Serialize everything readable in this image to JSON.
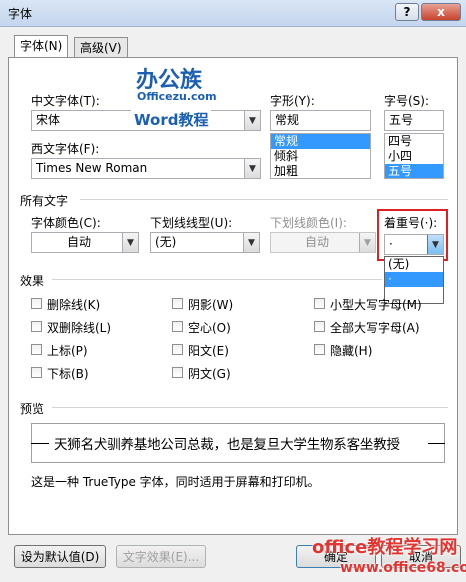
{
  "window": {
    "title": "字体",
    "help_label": "?",
    "close_label": "x"
  },
  "tabs": [
    {
      "label": "字体(N)",
      "active": true
    },
    {
      "label": "高级(V)",
      "active": false
    }
  ],
  "font_section": {
    "chinese_font_label": "中文字体(T):",
    "chinese_font_value": "宋体",
    "western_font_label": "西文字体(F):",
    "western_font_value": "Times New Roman",
    "style_label": "字形(Y):",
    "style_value": "常规",
    "style_options": [
      "常规",
      "倾斜",
      "加粗"
    ],
    "size_label": "字号(S):",
    "size_value": "五号",
    "size_options": [
      "四号",
      "小四",
      "五号"
    ]
  },
  "all_text": {
    "heading": "所有文字",
    "font_color_label": "字体颜色(C):",
    "font_color_value": "自动",
    "underline_style_label": "下划线线型(U):",
    "underline_style_value": "(无)",
    "underline_color_label": "下划线颜色(I):",
    "underline_color_value": "自动",
    "emphasis_label": "着重号(·):",
    "emphasis_value": "·",
    "emphasis_options": [
      "(无)",
      "·"
    ]
  },
  "effects": {
    "heading": "效果",
    "items": [
      "删除线(K)",
      "阴影(W)",
      "小型大写字母(M)",
      "双删除线(L)",
      "空心(O)",
      "全部大写字母(A)",
      "上标(P)",
      "阳文(E)",
      "隐藏(H)",
      "下标(B)",
      "阴文(G)"
    ]
  },
  "preview": {
    "heading": "预览",
    "sample_text": "天狮名犬驯养基地公司总裁，也是复旦大学生物系客坐教授",
    "note": "这是一种 TrueType 字体，同时适用于屏幕和打印机。"
  },
  "buttons": {
    "set_default": "设为默认值(D)",
    "text_effects": "文字效果(E)...",
    "ok": "确定",
    "cancel": "取消"
  },
  "watermarks": {
    "logo_main": "办公族",
    "logo_site": "Officezu.com",
    "logo_sub": "Word教程",
    "bottom_main": "office教程学习网",
    "bottom_site": "www.office68.com"
  },
  "colors": {
    "selection": "#3399ff",
    "highlight_border": "#e02020",
    "logo_blue": "#1a5fb4",
    "logo_red": "#e8382e",
    "watermark_red": "#e3342f"
  }
}
